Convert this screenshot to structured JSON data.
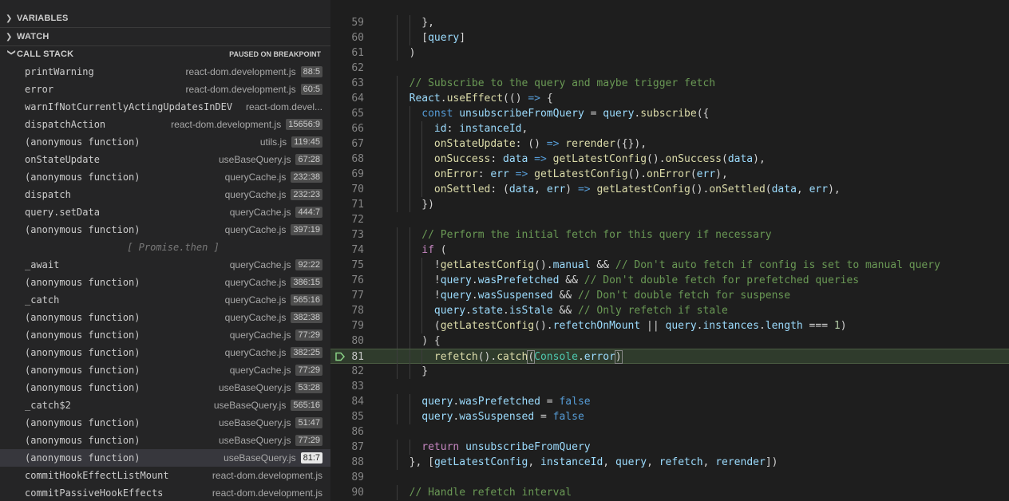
{
  "sections": {
    "variables": "VARIABLES",
    "watch": "WATCH",
    "callstack": "CALL STACK",
    "callstack_status": "PAUSED ON BREAKPOINT"
  },
  "call_stack": [
    {
      "name": "printWarning",
      "file": "react-dom.development.js",
      "loc": "88:5"
    },
    {
      "name": "error",
      "file": "react-dom.development.js",
      "loc": "60:5"
    },
    {
      "name": "warnIfNotCurrentlyActingUpdatesInDEV",
      "file": "react-dom.devel...",
      "loc": ""
    },
    {
      "name": "dispatchAction",
      "file": "react-dom.development.js",
      "loc": "15656:9"
    },
    {
      "name": "(anonymous function)",
      "file": "utils.js",
      "loc": "119:45"
    },
    {
      "name": "onStateUpdate",
      "file": "useBaseQuery.js",
      "loc": "67:28"
    },
    {
      "name": "(anonymous function)",
      "file": "queryCache.js",
      "loc": "232:38"
    },
    {
      "name": "dispatch",
      "file": "queryCache.js",
      "loc": "232:23"
    },
    {
      "name": "query.setData",
      "file": "queryCache.js",
      "loc": "444:7"
    },
    {
      "name": "(anonymous function)",
      "file": "queryCache.js",
      "loc": "397:19"
    },
    {
      "name": "[ Promise.then ]",
      "file": "",
      "loc": "",
      "subtle": true
    },
    {
      "name": "_await",
      "file": "queryCache.js",
      "loc": "92:22"
    },
    {
      "name": "(anonymous function)",
      "file": "queryCache.js",
      "loc": "386:15"
    },
    {
      "name": "_catch",
      "file": "queryCache.js",
      "loc": "565:16"
    },
    {
      "name": "(anonymous function)",
      "file": "queryCache.js",
      "loc": "382:38"
    },
    {
      "name": "(anonymous function)",
      "file": "queryCache.js",
      "loc": "77:29"
    },
    {
      "name": "(anonymous function)",
      "file": "queryCache.js",
      "loc": "382:25"
    },
    {
      "name": "(anonymous function)",
      "file": "queryCache.js",
      "loc": "77:29"
    },
    {
      "name": "(anonymous function)",
      "file": "useBaseQuery.js",
      "loc": "53:28"
    },
    {
      "name": "_catch$2",
      "file": "useBaseQuery.js",
      "loc": "565:16"
    },
    {
      "name": "(anonymous function)",
      "file": "useBaseQuery.js",
      "loc": "51:47"
    },
    {
      "name": "(anonymous function)",
      "file": "useBaseQuery.js",
      "loc": "77:29"
    },
    {
      "name": "(anonymous function)",
      "file": "useBaseQuery.js",
      "loc": "81:7",
      "selected": true
    },
    {
      "name": "commitHookEffectListMount",
      "file": "react-dom.development.js",
      "loc": ""
    },
    {
      "name": "commitPassiveHookEffects",
      "file": "react-dom.development.js",
      "loc": ""
    }
  ],
  "editor": {
    "current_line": 81,
    "lines": [
      {
        "n": "59",
        "indent": 2,
        "tokens": [
          {
            "t": "},",
            "c": "d"
          }
        ]
      },
      {
        "n": "60",
        "indent": 2,
        "tokens": [
          {
            "t": "[",
            "c": "d"
          },
          {
            "t": "query",
            "c": "v"
          },
          {
            "t": "]",
            "c": "d"
          }
        ]
      },
      {
        "n": "61",
        "indent": 1,
        "tokens": [
          {
            "t": ")",
            "c": "d"
          }
        ]
      },
      {
        "n": "62",
        "indent": 0,
        "tokens": []
      },
      {
        "n": "63",
        "indent": 1,
        "tokens": [
          {
            "t": "// Subscribe to the query and maybe trigger fetch",
            "c": "c"
          }
        ]
      },
      {
        "n": "64",
        "indent": 1,
        "tokens": [
          {
            "t": "React",
            "c": "v"
          },
          {
            "t": ".",
            "c": "d"
          },
          {
            "t": "useEffect",
            "c": "f"
          },
          {
            "t": "(() ",
            "c": "d"
          },
          {
            "t": "=>",
            "c": "k"
          },
          {
            "t": " {",
            "c": "d"
          }
        ]
      },
      {
        "n": "65",
        "indent": 2,
        "tokens": [
          {
            "t": "const ",
            "c": "k"
          },
          {
            "t": "unsubscribeFromQuery",
            "c": "v"
          },
          {
            "t": " = ",
            "c": "d"
          },
          {
            "t": "query",
            "c": "v"
          },
          {
            "t": ".",
            "c": "d"
          },
          {
            "t": "subscribe",
            "c": "f"
          },
          {
            "t": "({",
            "c": "d"
          }
        ]
      },
      {
        "n": "66",
        "indent": 3,
        "tokens": [
          {
            "t": "id",
            "c": "v"
          },
          {
            "t": ": ",
            "c": "d"
          },
          {
            "t": "instanceId",
            "c": "v"
          },
          {
            "t": ",",
            "c": "d"
          }
        ]
      },
      {
        "n": "67",
        "indent": 3,
        "tokens": [
          {
            "t": "onStateUpdate",
            "c": "f"
          },
          {
            "t": ": () ",
            "c": "d"
          },
          {
            "t": "=>",
            "c": "k"
          },
          {
            "t": " ",
            "c": "d"
          },
          {
            "t": "rerender",
            "c": "f"
          },
          {
            "t": "({}),",
            "c": "d"
          }
        ]
      },
      {
        "n": "68",
        "indent": 3,
        "tokens": [
          {
            "t": "onSuccess",
            "c": "f"
          },
          {
            "t": ": ",
            "c": "d"
          },
          {
            "t": "data",
            "c": "v"
          },
          {
            "t": " ",
            "c": "d"
          },
          {
            "t": "=>",
            "c": "k"
          },
          {
            "t": " ",
            "c": "d"
          },
          {
            "t": "getLatestConfig",
            "c": "f"
          },
          {
            "t": "().",
            "c": "d"
          },
          {
            "t": "onSuccess",
            "c": "f"
          },
          {
            "t": "(",
            "c": "d"
          },
          {
            "t": "data",
            "c": "v"
          },
          {
            "t": "),",
            "c": "d"
          }
        ]
      },
      {
        "n": "69",
        "indent": 3,
        "tokens": [
          {
            "t": "onError",
            "c": "f"
          },
          {
            "t": ": ",
            "c": "d"
          },
          {
            "t": "err",
            "c": "v"
          },
          {
            "t": " ",
            "c": "d"
          },
          {
            "t": "=>",
            "c": "k"
          },
          {
            "t": " ",
            "c": "d"
          },
          {
            "t": "getLatestConfig",
            "c": "f"
          },
          {
            "t": "().",
            "c": "d"
          },
          {
            "t": "onError",
            "c": "f"
          },
          {
            "t": "(",
            "c": "d"
          },
          {
            "t": "err",
            "c": "v"
          },
          {
            "t": "),",
            "c": "d"
          }
        ]
      },
      {
        "n": "70",
        "indent": 3,
        "tokens": [
          {
            "t": "onSettled",
            "c": "f"
          },
          {
            "t": ": (",
            "c": "d"
          },
          {
            "t": "data",
            "c": "v"
          },
          {
            "t": ", ",
            "c": "d"
          },
          {
            "t": "err",
            "c": "v"
          },
          {
            "t": ") ",
            "c": "d"
          },
          {
            "t": "=>",
            "c": "k"
          },
          {
            "t": " ",
            "c": "d"
          },
          {
            "t": "getLatestConfig",
            "c": "f"
          },
          {
            "t": "().",
            "c": "d"
          },
          {
            "t": "onSettled",
            "c": "f"
          },
          {
            "t": "(",
            "c": "d"
          },
          {
            "t": "data",
            "c": "v"
          },
          {
            "t": ", ",
            "c": "d"
          },
          {
            "t": "err",
            "c": "v"
          },
          {
            "t": "),",
            "c": "d"
          }
        ]
      },
      {
        "n": "71",
        "indent": 2,
        "tokens": [
          {
            "t": "})",
            "c": "d"
          }
        ]
      },
      {
        "n": "72",
        "indent": 0,
        "tokens": []
      },
      {
        "n": "73",
        "indent": 2,
        "tokens": [
          {
            "t": "// Perform the initial fetch for this query if necessary",
            "c": "c"
          }
        ]
      },
      {
        "n": "74",
        "indent": 2,
        "tokens": [
          {
            "t": "if",
            "c": "p"
          },
          {
            "t": " (",
            "c": "d"
          }
        ]
      },
      {
        "n": "75",
        "indent": 3,
        "tokens": [
          {
            "t": "!",
            "c": "d"
          },
          {
            "t": "getLatestConfig",
            "c": "f"
          },
          {
            "t": "().",
            "c": "d"
          },
          {
            "t": "manual",
            "c": "v"
          },
          {
            "t": " && ",
            "c": "d"
          },
          {
            "t": "// Don't auto fetch if config is set to manual query",
            "c": "c"
          }
        ]
      },
      {
        "n": "76",
        "indent": 3,
        "tokens": [
          {
            "t": "!",
            "c": "d"
          },
          {
            "t": "query",
            "c": "v"
          },
          {
            "t": ".",
            "c": "d"
          },
          {
            "t": "wasPrefetched",
            "c": "v"
          },
          {
            "t": " && ",
            "c": "d"
          },
          {
            "t": "// Don't double fetch for prefetched queries",
            "c": "c"
          }
        ]
      },
      {
        "n": "77",
        "indent": 3,
        "tokens": [
          {
            "t": "!",
            "c": "d"
          },
          {
            "t": "query",
            "c": "v"
          },
          {
            "t": ".",
            "c": "d"
          },
          {
            "t": "wasSuspensed",
            "c": "v"
          },
          {
            "t": " && ",
            "c": "d"
          },
          {
            "t": "// Don't double fetch for suspense",
            "c": "c"
          }
        ]
      },
      {
        "n": "78",
        "indent": 3,
        "tokens": [
          {
            "t": "query",
            "c": "v"
          },
          {
            "t": ".",
            "c": "d"
          },
          {
            "t": "state",
            "c": "v"
          },
          {
            "t": ".",
            "c": "d"
          },
          {
            "t": "isStale",
            "c": "v"
          },
          {
            "t": " && ",
            "c": "d"
          },
          {
            "t": "// Only refetch if stale",
            "c": "c"
          }
        ]
      },
      {
        "n": "79",
        "indent": 3,
        "tokens": [
          {
            "t": "(",
            "c": "d"
          },
          {
            "t": "getLatestConfig",
            "c": "f"
          },
          {
            "t": "().",
            "c": "d"
          },
          {
            "t": "refetchOnMount",
            "c": "v"
          },
          {
            "t": " || ",
            "c": "d"
          },
          {
            "t": "query",
            "c": "v"
          },
          {
            "t": ".",
            "c": "d"
          },
          {
            "t": "instances",
            "c": "v"
          },
          {
            "t": ".",
            "c": "d"
          },
          {
            "t": "length",
            "c": "v"
          },
          {
            "t": " === ",
            "c": "d"
          },
          {
            "t": "1",
            "c": "n"
          },
          {
            "t": ")",
            "c": "d"
          }
        ]
      },
      {
        "n": "80",
        "indent": 2,
        "tokens": [
          {
            "t": ") {",
            "c": "d"
          }
        ]
      },
      {
        "n": "81",
        "indent": 3,
        "tokens": [
          {
            "t": "refetch",
            "c": "f"
          },
          {
            "t": "().",
            "c": "d"
          },
          {
            "t": "catch",
            "c": "f"
          },
          {
            "t": "(",
            "c": "d",
            "b": true
          },
          {
            "t": "Console",
            "c": "t"
          },
          {
            "t": ".",
            "c": "d"
          },
          {
            "t": "error",
            "c": "v"
          },
          {
            "t": ")",
            "c": "d",
            "b": true
          }
        ]
      },
      {
        "n": "82",
        "indent": 2,
        "tokens": [
          {
            "t": "}",
            "c": "d"
          }
        ]
      },
      {
        "n": "83",
        "indent": 0,
        "tokens": []
      },
      {
        "n": "84",
        "indent": 2,
        "tokens": [
          {
            "t": "query",
            "c": "v"
          },
          {
            "t": ".",
            "c": "d"
          },
          {
            "t": "wasPrefetched",
            "c": "v"
          },
          {
            "t": " = ",
            "c": "d"
          },
          {
            "t": "false",
            "c": "k"
          }
        ]
      },
      {
        "n": "85",
        "indent": 2,
        "tokens": [
          {
            "t": "query",
            "c": "v"
          },
          {
            "t": ".",
            "c": "d"
          },
          {
            "t": "wasSuspensed",
            "c": "v"
          },
          {
            "t": " = ",
            "c": "d"
          },
          {
            "t": "false",
            "c": "k"
          }
        ]
      },
      {
        "n": "86",
        "indent": 0,
        "tokens": []
      },
      {
        "n": "87",
        "indent": 2,
        "tokens": [
          {
            "t": "return",
            "c": "p"
          },
          {
            "t": " ",
            "c": "d"
          },
          {
            "t": "unsubscribeFromQuery",
            "c": "v"
          }
        ]
      },
      {
        "n": "88",
        "indent": 1,
        "tokens": [
          {
            "t": "}, [",
            "c": "d"
          },
          {
            "t": "getLatestConfig",
            "c": "v"
          },
          {
            "t": ", ",
            "c": "d"
          },
          {
            "t": "instanceId",
            "c": "v"
          },
          {
            "t": ", ",
            "c": "d"
          },
          {
            "t": "query",
            "c": "v"
          },
          {
            "t": ", ",
            "c": "d"
          },
          {
            "t": "refetch",
            "c": "v"
          },
          {
            "t": ", ",
            "c": "d"
          },
          {
            "t": "rerender",
            "c": "v"
          },
          {
            "t": "])",
            "c": "d"
          }
        ]
      },
      {
        "n": "89",
        "indent": 0,
        "tokens": []
      },
      {
        "n": "90",
        "indent": 1,
        "tokens": [
          {
            "t": "// Handle refetch interval",
            "c": "c"
          }
        ]
      }
    ]
  },
  "colors": {
    "breakpoint_arrow": "#89d185",
    "current_line_bg": "#2f3b2c"
  }
}
